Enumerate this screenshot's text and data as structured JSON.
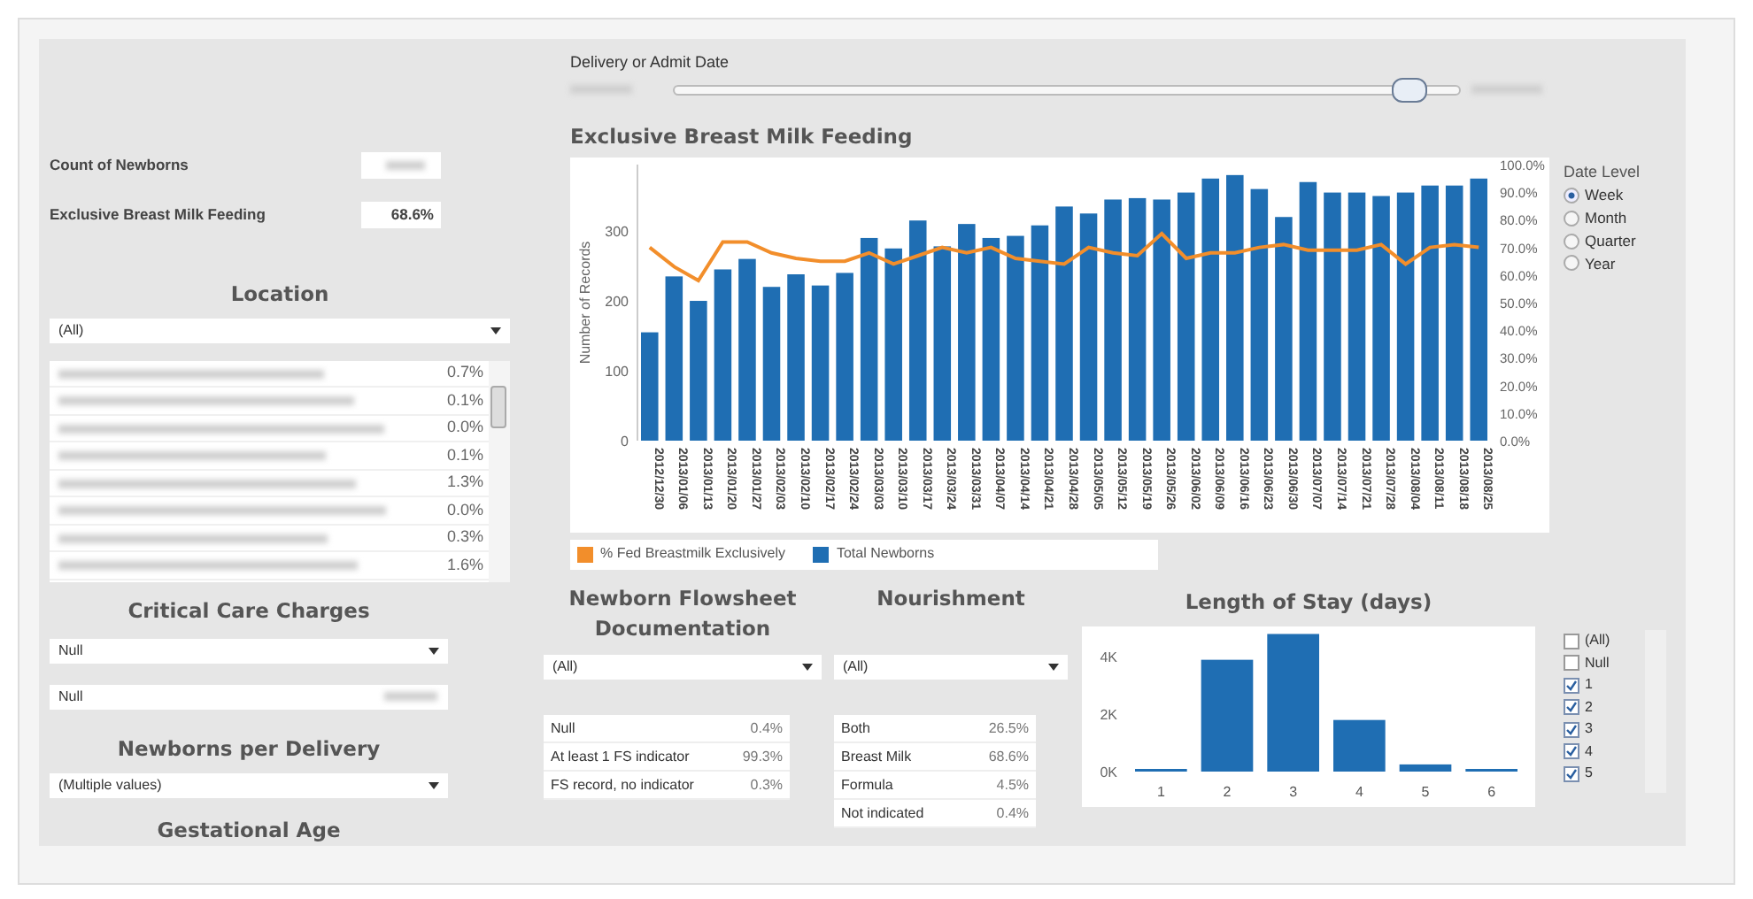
{
  "slider": {
    "label": "Delivery or Admit Date",
    "level": 0.95
  },
  "kpis": [
    {
      "label": "Count of Newborns"
    },
    {
      "label": "Exclusive Breast Milk Feeding",
      "value": "68.6%"
    }
  ],
  "location": {
    "title": "Location",
    "dropdown": "(All)",
    "rows": [
      {
        "value": "0.7%"
      },
      {
        "value": "0.1%"
      },
      {
        "value": "0.0%"
      },
      {
        "value": "0.1%"
      },
      {
        "value": "1.3%"
      },
      {
        "value": "0.0%"
      },
      {
        "value": "0.3%"
      },
      {
        "value": "1.6%"
      }
    ]
  },
  "critical_care": {
    "title": "Critical Care Charges",
    "dropdown": "Null",
    "field": "Null"
  },
  "newborns_per_delivery": {
    "title": "Newborns per Delivery",
    "dropdown": "(Multiple values)"
  },
  "gestational_age": {
    "title": "Gestational Age"
  },
  "main_chart": {
    "title": "Exclusive Breast Milk Feeding",
    "chart_data": {
      "type": "bar",
      "ylabel": "Number of Records",
      "categories": [
        "2012/12/30",
        "2013/01/06",
        "2013/01/13",
        "2013/01/20",
        "2013/01/27",
        "2013/02/03",
        "2013/02/10",
        "2013/02/17",
        "2013/02/24",
        "2013/03/03",
        "2013/03/10",
        "2013/03/17",
        "2013/03/24",
        "2013/03/31",
        "2013/04/07",
        "2013/04/14",
        "2013/04/21",
        "2013/04/28",
        "2013/05/05",
        "2013/05/12",
        "2013/05/19",
        "2013/05/26",
        "2013/06/02",
        "2013/06/09",
        "2013/06/16",
        "2013/06/23",
        "2013/06/30",
        "2013/07/07",
        "2013/07/14",
        "2013/07/21",
        "2013/07/28",
        "2013/08/04",
        "2013/08/11",
        "2013/08/18",
        "2013/08/25"
      ],
      "legend": true,
      "series": [
        {
          "name": "% Fed Breastmilk Exclusively",
          "color": "#f28e2b",
          "type": "line",
          "axis": "y2",
          "values": [
            70,
            63,
            58,
            72,
            72,
            68,
            66,
            65,
            65,
            68,
            64,
            67,
            70,
            68,
            70,
            66,
            65,
            64,
            70,
            68,
            67,
            75,
            66,
            68,
            68,
            70,
            71,
            69,
            69,
            69,
            71,
            64,
            70,
            71,
            70
          ]
        },
        {
          "name": "Total Newborns",
          "color": "#1f6eb3",
          "type": "bar",
          "values": [
            155,
            235,
            200,
            245,
            260,
            220,
            238,
            222,
            240,
            290,
            275,
            315,
            278,
            310,
            290,
            293,
            308,
            335,
            325,
            345,
            347,
            345,
            355,
            375,
            380,
            360,
            320,
            370,
            355,
            355,
            350,
            355,
            365,
            365,
            375
          ]
        }
      ],
      "ylim": [
        0,
        395
      ],
      "yticks": [
        0,
        100,
        200,
        300
      ],
      "y2lim": [
        0,
        100
      ],
      "y2ticks": [
        {
          "value": 0,
          "label": "0.0%"
        },
        {
          "value": 10,
          "label": "10.0%"
        },
        {
          "value": 20,
          "label": "20.0%"
        },
        {
          "value": 30,
          "label": "30.0%"
        },
        {
          "value": 40,
          "label": "40.0%"
        },
        {
          "value": 50,
          "label": "50.0%"
        },
        {
          "value": 60,
          "label": "60.0%"
        },
        {
          "value": 70,
          "label": "70.0%"
        },
        {
          "value": 80,
          "label": "80.0%"
        },
        {
          "value": 90,
          "label": "90.0%"
        },
        {
          "value": 100,
          "label": "100.0%"
        }
      ]
    }
  },
  "date_level": {
    "title": "Date Level",
    "options": [
      {
        "label": "Week",
        "selected": true
      },
      {
        "label": "Month",
        "selected": false
      },
      {
        "label": "Quarter",
        "selected": false
      },
      {
        "label": "Year",
        "selected": false
      }
    ]
  },
  "flowsheet": {
    "title": "Newborn Flowsheet Documentation",
    "dropdown": "(All)",
    "rows": [
      {
        "label": "Null",
        "value": "0.4%"
      },
      {
        "label": "At least 1 FS indicator",
        "value": "99.3%"
      },
      {
        "label": "FS record, no indicator",
        "value": "0.3%"
      }
    ]
  },
  "nourishment": {
    "title": "Nourishment",
    "dropdown": "(All)",
    "rows": [
      {
        "label": "Both",
        "value": "26.5%"
      },
      {
        "label": "Breast Milk",
        "value": "68.6%"
      },
      {
        "label": "Formula",
        "value": "4.5%"
      },
      {
        "label": "Not indicated",
        "value": "0.4%"
      }
    ]
  },
  "length_of_stay": {
    "title": "Length of Stay (days)",
    "chart_data": {
      "type": "bar",
      "categories": [
        "1",
        "2",
        "3",
        "4",
        "5",
        "6"
      ],
      "series": [
        {
          "color": "#1f6eb3",
          "values": [
            70,
            3900,
            4800,
            1800,
            250,
            30
          ]
        }
      ],
      "ylim": [
        0,
        5000
      ],
      "yticks": [
        {
          "value": 0,
          "label": "0K"
        },
        {
          "value": 2000,
          "label": "2K"
        },
        {
          "value": 4000,
          "label": "4K"
        }
      ]
    }
  },
  "stay_filter": {
    "items": [
      {
        "label": "(All)",
        "checked": false
      },
      {
        "label": "Null",
        "checked": false
      },
      {
        "label": "1",
        "checked": true
      },
      {
        "label": "2",
        "checked": true
      },
      {
        "label": "3",
        "checked": true
      },
      {
        "label": "4",
        "checked": true
      },
      {
        "label": "5",
        "checked": true
      }
    ]
  }
}
